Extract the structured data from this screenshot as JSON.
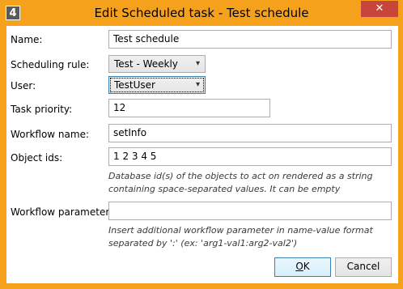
{
  "window": {
    "title": "Edit Scheduled task - Test schedule",
    "app_icon_glyph": "4",
    "close_glyph": "✕",
    "accent": "#f6a11c",
    "close_color": "#c7453b"
  },
  "form": {
    "name": {
      "label": "Name:",
      "value": "Test schedule"
    },
    "scheduling_rule": {
      "label": "Scheduling rule:",
      "value": "Test - Weekly"
    },
    "user": {
      "label": "User:",
      "value": "TestUser"
    },
    "task_priority": {
      "label": "Task priority:",
      "value": "12"
    },
    "workflow_name": {
      "label": "Workflow name:",
      "value": "setInfo"
    },
    "object_ids": {
      "label": "Object ids:",
      "value": "1 2 3 4 5",
      "hint_line1": "Database id(s) of the objects to act on rendered as a string",
      "hint_line2": "containing space-separated values. It can be empty"
    },
    "workflow_parameters": {
      "label": "Workflow parameters:",
      "value": "",
      "hint_line1": "Insert additional workflow parameter in name-value format",
      "hint_line2": "separated by ':' (ex: 'arg1-val1:arg2-val2')"
    }
  },
  "buttons": {
    "ok_access_key": "O",
    "ok_rest": "K",
    "cancel": "Cancel"
  }
}
